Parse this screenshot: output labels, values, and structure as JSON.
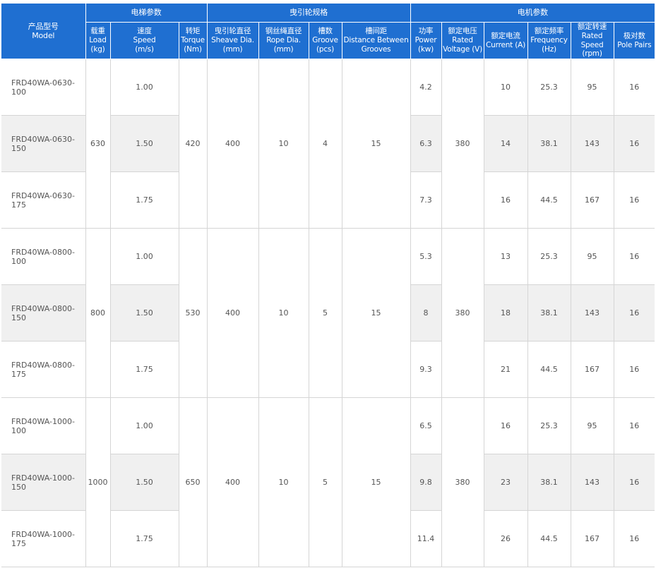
{
  "header": {
    "model": "产品型号\nModel",
    "group_elevator": "电梯参数",
    "group_sheave": "曳引轮规格",
    "group_motor": "电机参数",
    "columns": [
      "载重\nLoad\n(kg)",
      "速度\nSpeed\n(m/s)",
      "转矩\nTorque\n(Nm)",
      "曳引轮直径\nSheave Dia.\n(mm)",
      "钢丝绳直径\nRope Dia.\n(mm)",
      "槽数\nGroove\n(pcs)",
      "槽间距\nDistance Between\nGrooves",
      "功率\nPower\n(kw)",
      "额定电压\nRated\nVoltage (V)",
      "额定电流\nCurrent (A)",
      "额定频率\nFrequency\n(Hz)",
      "额定转速\nRated Speed\n(rpm)",
      "极对数\nPole Pairs"
    ]
  },
  "groups": [
    {
      "load": "630",
      "torque": "420",
      "sheave_dia": "400",
      "rope_dia": "10",
      "grooves": "4",
      "groove_distance": "15",
      "voltage": "380",
      "rows": [
        {
          "model": "FRD40WA-0630-100",
          "speed": "1.00",
          "power": "4.2",
          "current": "10",
          "frequency": "25.3",
          "rpm": "95",
          "pole_pairs": "16"
        },
        {
          "model": "FRD40WA-0630-150",
          "speed": "1.50",
          "power": "6.3",
          "current": "14",
          "frequency": "38.1",
          "rpm": "143",
          "pole_pairs": "16"
        },
        {
          "model": "FRD40WA-0630-175",
          "speed": "1.75",
          "power": "7.3",
          "current": "16",
          "frequency": "44.5",
          "rpm": "167",
          "pole_pairs": "16"
        }
      ]
    },
    {
      "load": "800",
      "torque": "530",
      "sheave_dia": "400",
      "rope_dia": "10",
      "grooves": "5",
      "groove_distance": "15",
      "voltage": "380",
      "rows": [
        {
          "model": "FRD40WA-0800-100",
          "speed": "1.00",
          "power": "5.3",
          "current": "13",
          "frequency": "25.3",
          "rpm": "95",
          "pole_pairs": "16"
        },
        {
          "model": "FRD40WA-0800-150",
          "speed": "1.50",
          "power": "8",
          "current": "18",
          "frequency": "38.1",
          "rpm": "143",
          "pole_pairs": "16"
        },
        {
          "model": "FRD40WA-0800-175",
          "speed": "1.75",
          "power": "9.3",
          "current": "21",
          "frequency": "44.5",
          "rpm": "167",
          "pole_pairs": "16"
        }
      ]
    },
    {
      "load": "1000",
      "torque": "650",
      "sheave_dia": "400",
      "rope_dia": "10",
      "grooves": "5",
      "groove_distance": "15",
      "voltage": "380",
      "rows": [
        {
          "model": "FRD40WA-1000-100",
          "speed": "1.00",
          "power": "6.5",
          "current": "16",
          "frequency": "25.3",
          "rpm": "95",
          "pole_pairs": "16"
        },
        {
          "model": "FRD40WA-1000-150",
          "speed": "1.50",
          "power": "9.8",
          "current": "23",
          "frequency": "38.1",
          "rpm": "143",
          "pole_pairs": "16"
        },
        {
          "model": "FRD40WA-1000-175",
          "speed": "1.75",
          "power": "11.4",
          "current": "26",
          "frequency": "44.5",
          "rpm": "167",
          "pole_pairs": "16"
        }
      ]
    }
  ],
  "colors": {
    "header_bg": "#1f6fd1",
    "header_text": "#ffffff",
    "row_shade": "#f0f0f0",
    "grid_line": "#d5d5d5",
    "cell_text": "#555555"
  }
}
